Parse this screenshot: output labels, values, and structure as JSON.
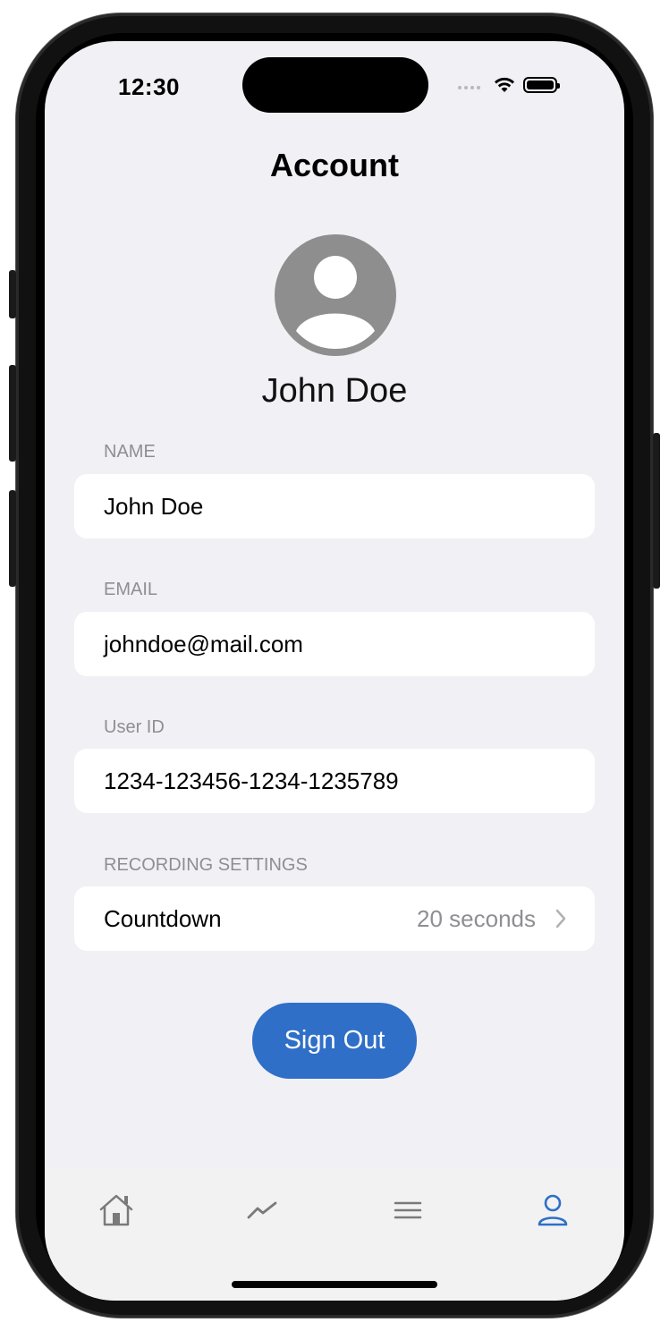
{
  "status_bar": {
    "time": "12:30"
  },
  "header": {
    "title": "Account"
  },
  "profile": {
    "display_name": "John Doe"
  },
  "fields": {
    "name": {
      "label": "NAME",
      "value": "John Doe"
    },
    "email": {
      "label": "EMAIL",
      "value": "johndoe@mail.com"
    },
    "user_id": {
      "label": "User ID",
      "value": "1234-123456-1234-1235789"
    }
  },
  "recording": {
    "label": "RECORDING SETTINGS",
    "countdown_label": "Countdown",
    "countdown_value": "20 seconds"
  },
  "actions": {
    "sign_out": "Sign Out"
  },
  "tabbar": {
    "items": [
      {
        "icon": "home-icon",
        "active": false
      },
      {
        "icon": "trend-icon",
        "active": false
      },
      {
        "icon": "menu-icon",
        "active": false
      },
      {
        "icon": "person-icon",
        "active": true
      }
    ]
  },
  "colors": {
    "accent": "#2f6fc7",
    "background": "#f0f0f5",
    "secondary_text": "#8e8e93",
    "inactive_icon": "#7a7a7a"
  }
}
